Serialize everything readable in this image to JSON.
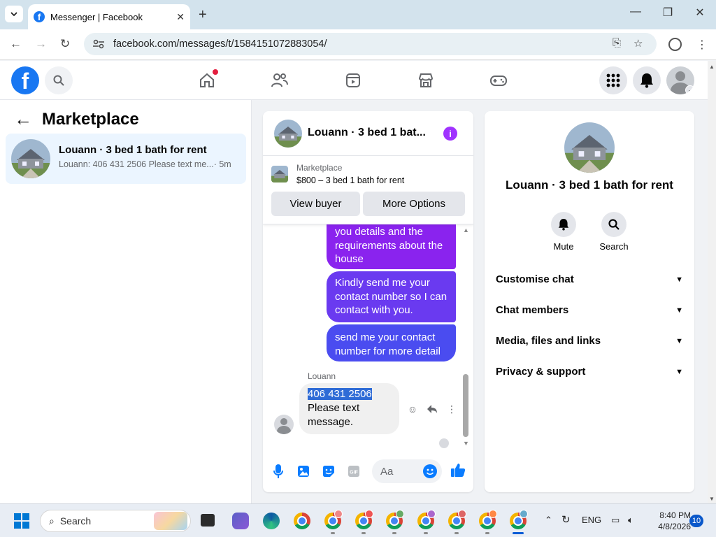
{
  "browser": {
    "tab_title": "Messenger | Facebook",
    "url": "facebook.com/messages/t/1584151072883054/"
  },
  "left_panel": {
    "title": "Marketplace",
    "conversation": {
      "name": "Louann · 3 bed 1 bath for rent",
      "snippet": "Louann: 406 431 2506 Please text me...",
      "time": "· 5m"
    }
  },
  "chat": {
    "header_name": "Louann · 3 bed 1 bat...",
    "marketplace_label": "Marketplace",
    "listing": "$800 – 3 bed 1 bath for rent",
    "view_buyer": "View buyer",
    "more_options": "More Options",
    "messages": [
      "you details and the requirements about the house",
      "Kindly send me your contact number so I can contact with you.",
      "send me your contact number for more detail"
    ],
    "sender": "Louann",
    "incoming_selected": "406 431 2506",
    "incoming_rest": "Please text message.",
    "composer_placeholder": "Aa"
  },
  "info_panel": {
    "title": "Louann · 3 bed 1 bath for rent",
    "mute": "Mute",
    "search": "Search",
    "sections": [
      "Customise chat",
      "Chat members",
      "Media, files and links",
      "Privacy & support"
    ]
  },
  "taskbar": {
    "search": "Search",
    "lang": "ENG",
    "time": "8:40 PM",
    "date": "4/8/2026",
    "notifications": "10"
  },
  "colors": {
    "fb_blue": "#1877f2",
    "bubble_purple": "#8a23ee",
    "bubble_violet": "#6a3af0",
    "bubble_indigo": "#4a4cf0",
    "info_purple": "#a033ff"
  }
}
